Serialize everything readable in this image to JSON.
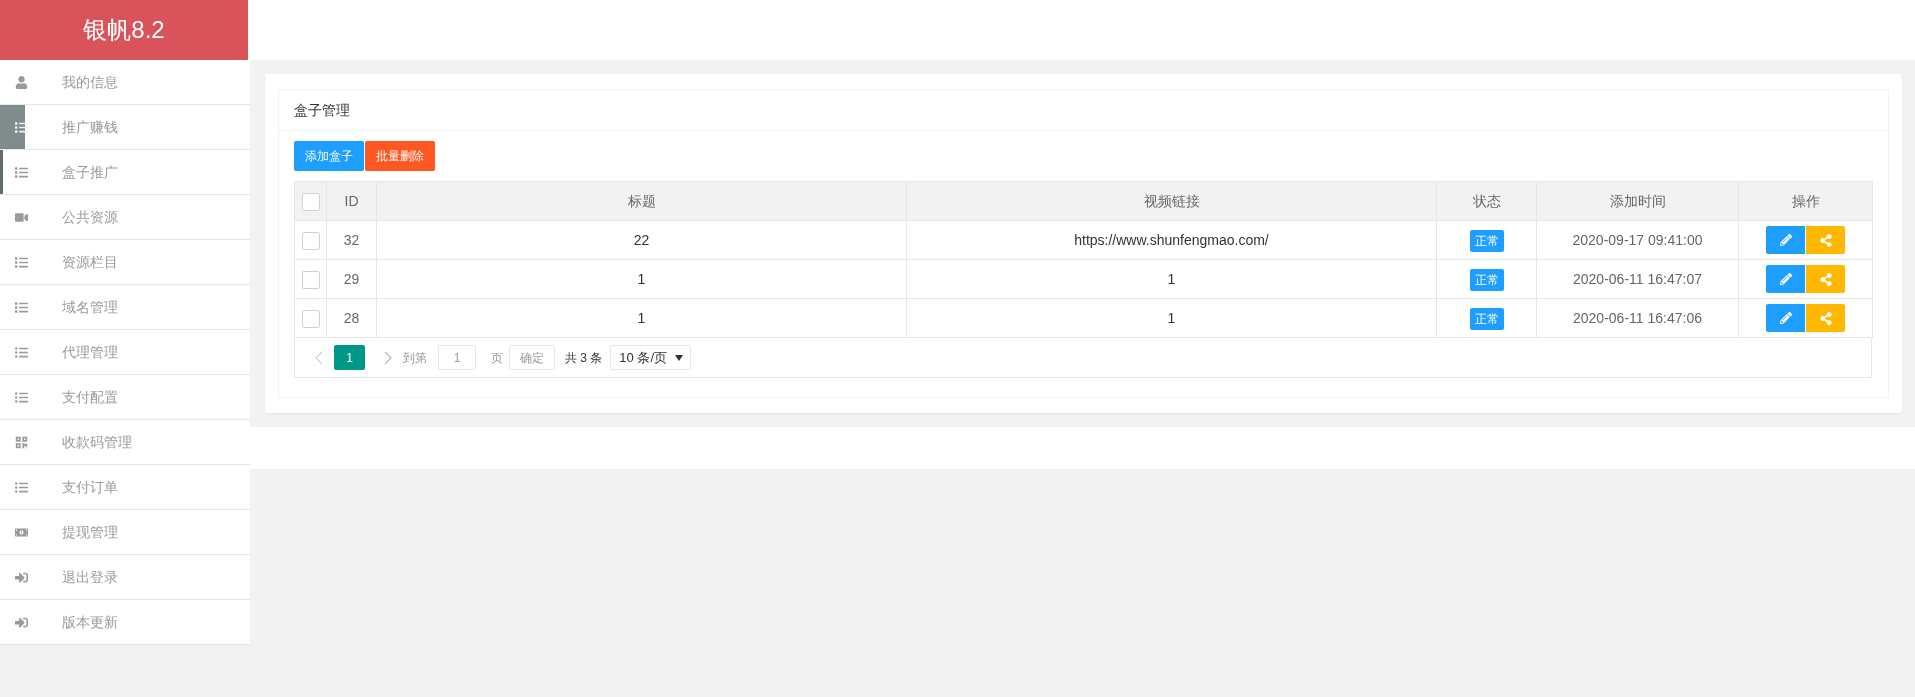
{
  "sidebar": {
    "logo": "银帆8.2",
    "items": [
      {
        "label": "我的信息",
        "kind": "user",
        "selected": false,
        "hovered": false
      },
      {
        "label": "推广赚钱",
        "kind": "list",
        "selected": false,
        "hovered": true
      },
      {
        "label": "盒子推广",
        "kind": "list",
        "selected": true,
        "hovered": false
      },
      {
        "label": "公共资源",
        "kind": "video",
        "selected": false,
        "hovered": false
      },
      {
        "label": "资源栏目",
        "kind": "list",
        "selected": false,
        "hovered": false
      },
      {
        "label": "域名管理",
        "kind": "list",
        "selected": false,
        "hovered": false
      },
      {
        "label": "代理管理",
        "kind": "bullets",
        "selected": false,
        "hovered": false
      },
      {
        "label": "支付配置",
        "kind": "bullets",
        "selected": false,
        "hovered": false
      },
      {
        "label": "收款码管理",
        "kind": "qrcode",
        "selected": false,
        "hovered": false
      },
      {
        "label": "支付订单",
        "kind": "bullets",
        "selected": false,
        "hovered": false
      },
      {
        "label": "提现管理",
        "kind": "money",
        "selected": false,
        "hovered": false
      },
      {
        "label": "退出登录",
        "kind": "login",
        "selected": false,
        "hovered": false
      },
      {
        "label": "版本更新",
        "kind": "login",
        "selected": false,
        "hovered": false
      }
    ]
  },
  "panel": {
    "title": "盒子管理",
    "buttons": [
      {
        "label": "添加盒子",
        "kind": "add"
      },
      {
        "label": "批量删除",
        "kind": "delete"
      }
    ]
  },
  "table": {
    "select_all": {
      "checked": false
    },
    "columns": [
      "ID",
      "标题",
      "视频链接",
      "状态",
      "添加时间",
      "操作"
    ],
    "rows": [
      {
        "checked": false,
        "id": "32",
        "title": "22",
        "video_link": "https://www.shunfengmao.com/",
        "status": "正常",
        "added_time": "2020-09-17 09:41:00"
      },
      {
        "checked": false,
        "id": "29",
        "title": "1",
        "video_link": "1",
        "status": "正常",
        "added_time": "2020-06-11 16:47:07"
      },
      {
        "checked": false,
        "id": "28",
        "title": "1",
        "video_link": "1",
        "status": "正常",
        "added_time": "2020-06-11 16:47:06"
      }
    ]
  },
  "pagination": {
    "pages": [
      {
        "label": "1",
        "selected": true
      }
    ],
    "goto_label": "到第",
    "goto_value": "1",
    "page_suffix": "页",
    "confirm": "确定",
    "total": "共 3 条",
    "page_size": "10 条/页"
  }
}
